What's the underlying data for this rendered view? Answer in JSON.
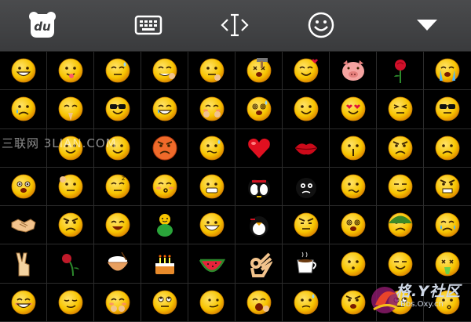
{
  "toolbar": {
    "logo_text": "du",
    "buttons": [
      {
        "name": "baidu-logo-icon"
      },
      {
        "name": "keyboard-icon"
      },
      {
        "name": "cursor-move-icon"
      },
      {
        "name": "smiley-face-icon"
      },
      {
        "name": "collapse-triangle-icon"
      }
    ]
  },
  "emoji_grid": {
    "rows": 7,
    "columns": 10,
    "items": [
      [
        "grin",
        "tongue-out",
        "sweat-meh",
        "snicker",
        "thinking",
        "hammer-knock",
        "heart-pick",
        "pig-head",
        "rose",
        "crying"
      ],
      [
        "sad-tear",
        "pray",
        "cool-boss",
        "laugh-tears",
        "shy-hide",
        "dizzy-sweat",
        "smile",
        "heart-eyes",
        "squint-tired",
        "sunglasses"
      ],
      [
        "blank-1",
        "blank-2",
        "blank-3",
        "angry-cry",
        "nervous-sweat",
        "red-heart",
        "red-lips",
        "shh",
        "frown",
        "unhappy"
      ],
      [
        "wow",
        "scratch-head",
        "sleepy",
        "kiss",
        "grimace",
        "penguin-couple",
        "black-bomb-face",
        "confused",
        "smirk",
        "furious"
      ],
      [
        "handshake",
        "fierce",
        "haha-tongue",
        "green-guy",
        "big-grin",
        "penguin-hug",
        "grumpy",
        "spiral-dizzy",
        "army-helmet",
        "pout-cry"
      ],
      [
        "victory-hand",
        "wilted-rose",
        "rice-bowl",
        "birthday-cake",
        "watermelon",
        "ok-hand",
        "coffee",
        "hush",
        "meh-smile",
        "vomit"
      ],
      [
        "blush",
        "sly",
        "shy-cover",
        "eyes-up",
        "side-smirk",
        "yawn",
        "worried",
        "angry-red",
        "rolling-eyes",
        "wondering"
      ]
    ]
  },
  "watermarks": {
    "left": "三联网 3LIAN.COM",
    "right_title": "格.Y社区",
    "right_sub": "Bbs.Oxy.cn"
  },
  "colors": {
    "toolbar_bg": "#404143",
    "icon_color": "#ffffff",
    "grid_bg": "#000000",
    "grid_line": "#2c2c2c",
    "emoji_yellow": "#f7c400",
    "emoji_shade": "#e08e00"
  }
}
